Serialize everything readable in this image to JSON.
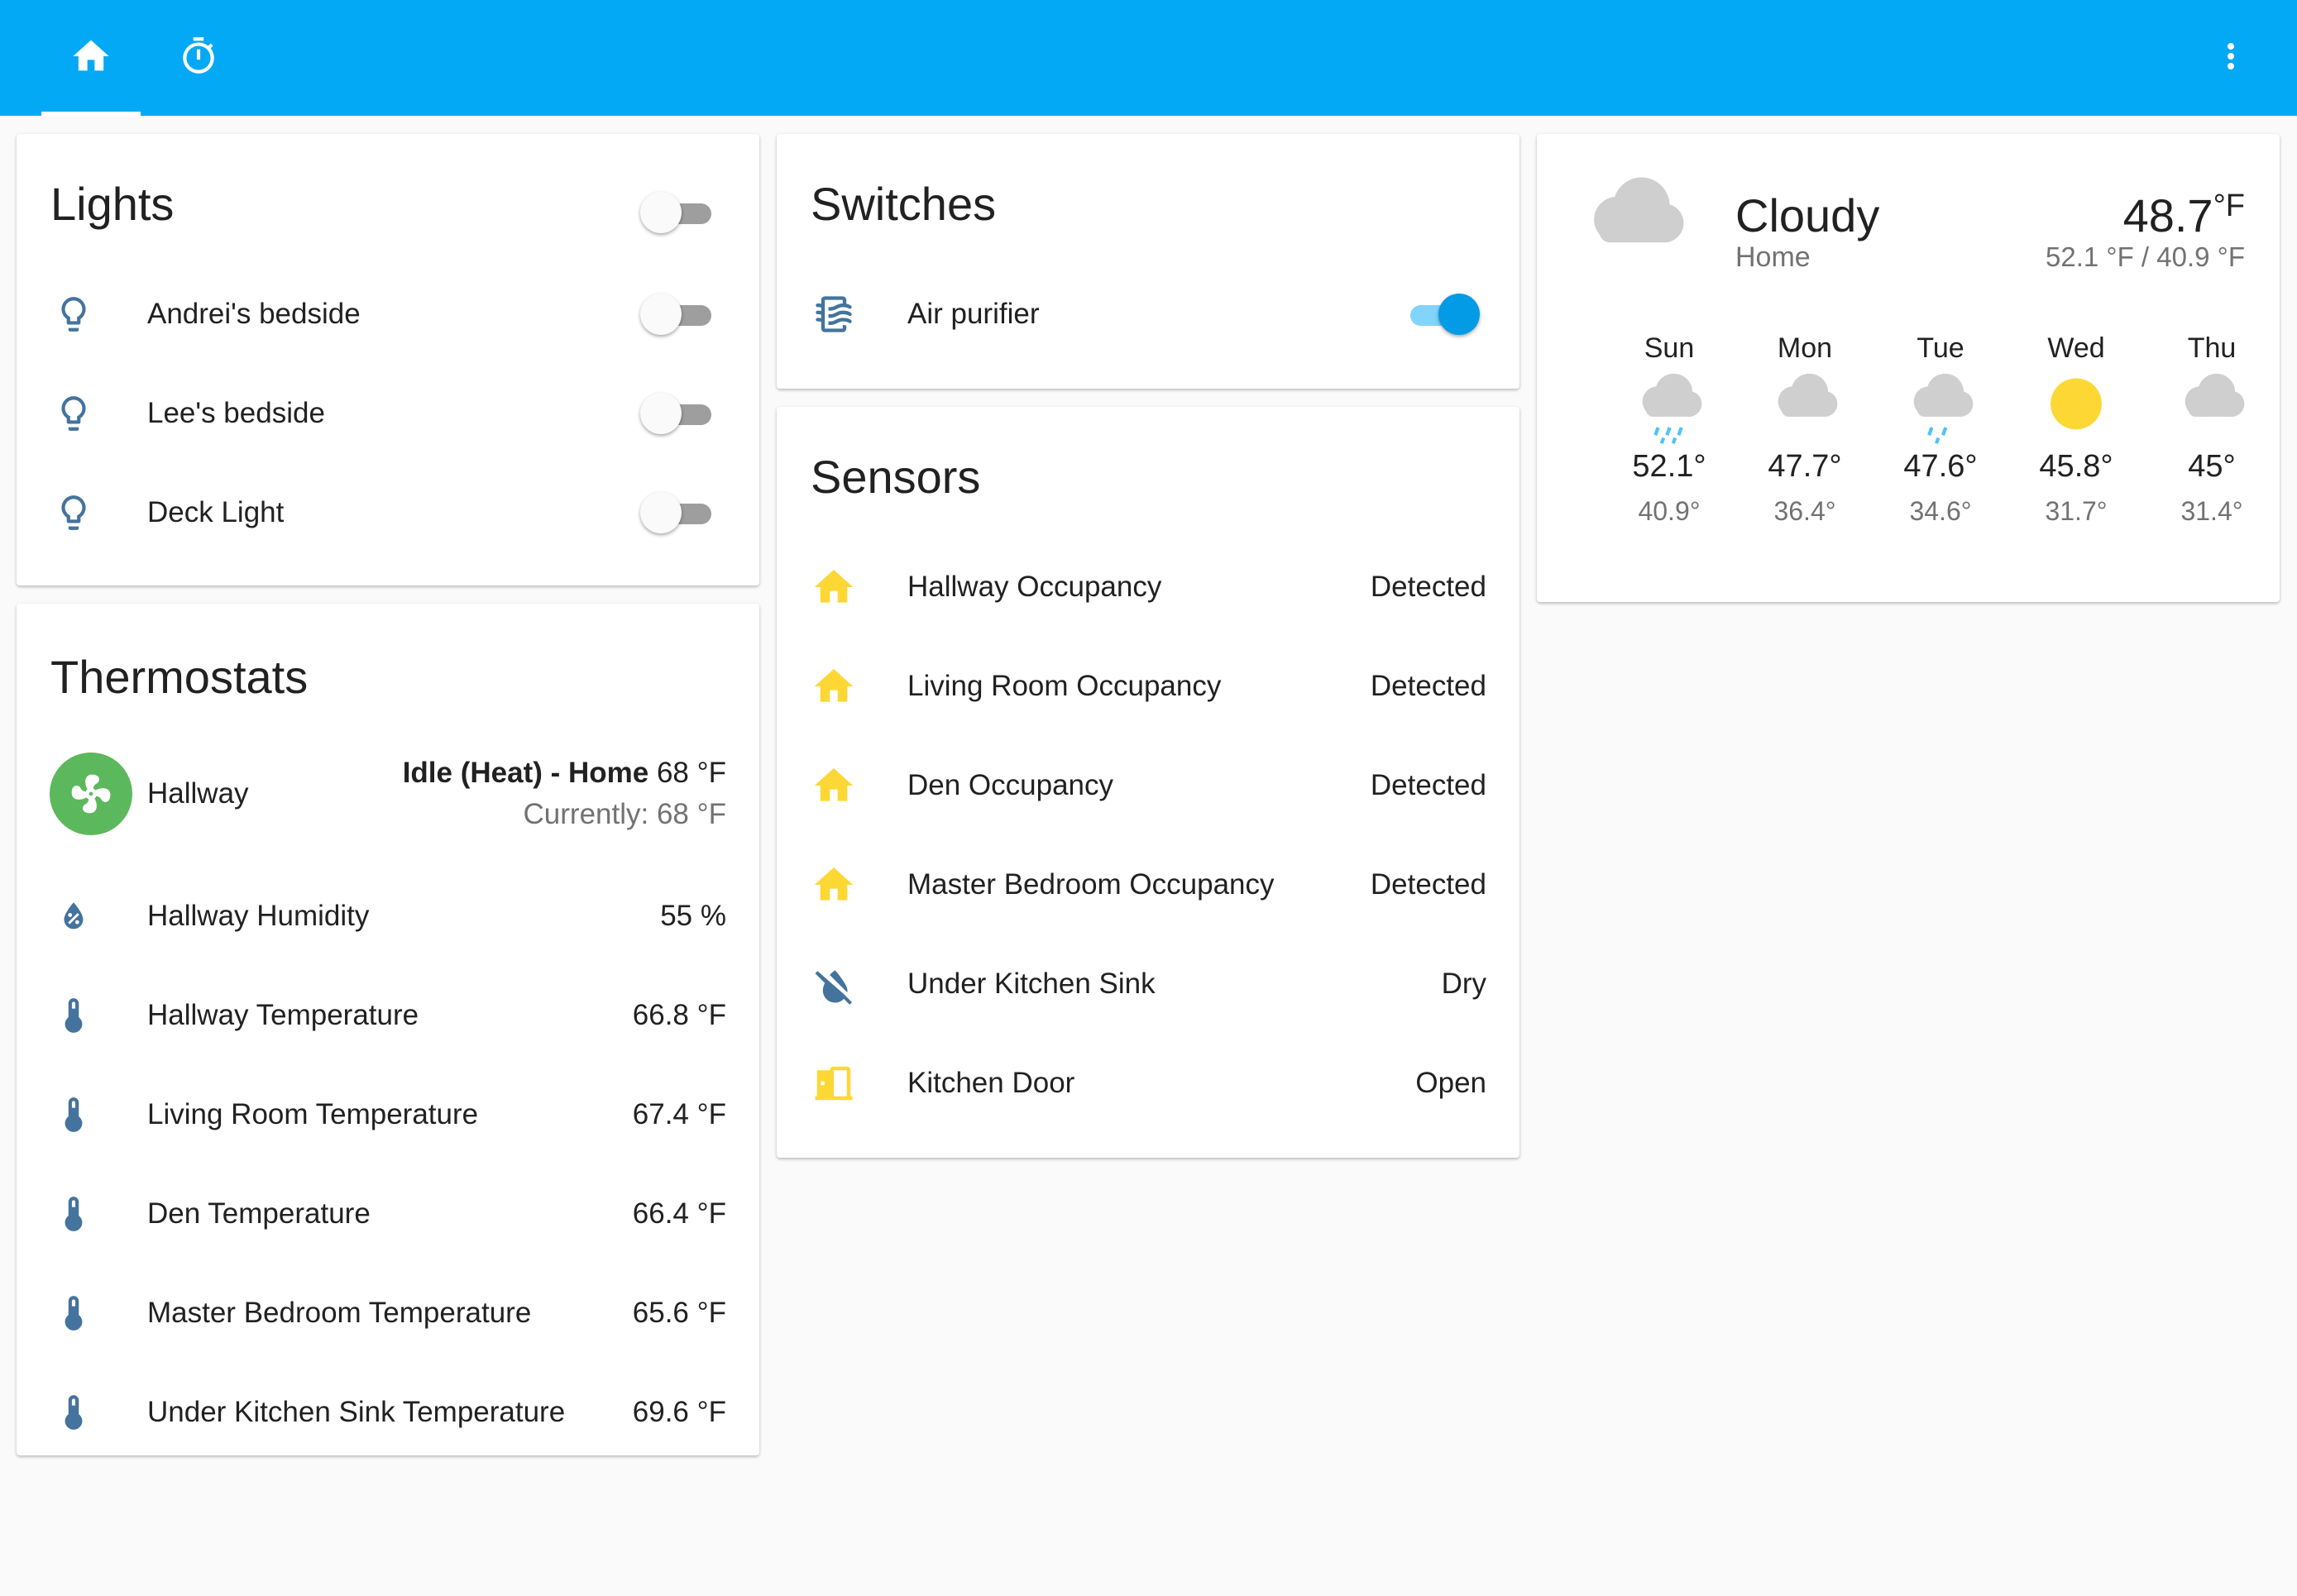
{
  "topbar": {
    "tabs": [
      {
        "icon": "home-icon"
      },
      {
        "icon": "timer-icon"
      }
    ],
    "menu_icon": "more-vertical-icon"
  },
  "colors": {
    "header": "#03a9f4",
    "icon_blue": "#44739e",
    "icon_yellow": "#fdd835",
    "switch_on": "#039be5",
    "thermostat_badge": "#5cb85c"
  },
  "lights": {
    "title": "Lights",
    "group_toggle_on": false,
    "items": [
      {
        "name": "Andrei's bedside",
        "icon": "lightbulb-outline-icon",
        "on": false
      },
      {
        "name": "Lee's bedside",
        "icon": "lightbulb-outline-icon",
        "on": false
      },
      {
        "name": "Deck Light",
        "icon": "lightbulb-outline-icon",
        "on": false
      }
    ]
  },
  "thermostats": {
    "title": "Thermostats",
    "main": {
      "name": "Hallway",
      "state_bold": "Idle (Heat) - Home",
      "target": "68 °F",
      "current": "Currently: 68 °F"
    },
    "items": [
      {
        "name": "Hallway Humidity",
        "value": "55 %",
        "icon": "water-percent-icon"
      },
      {
        "name": "Hallway Temperature",
        "value": "66.8 °F",
        "icon": "thermometer-icon"
      },
      {
        "name": "Living Room Temperature",
        "value": "67.4 °F",
        "icon": "thermometer-icon"
      },
      {
        "name": "Den Temperature",
        "value": "66.4 °F",
        "icon": "thermometer-icon"
      },
      {
        "name": "Master Bedroom Temperature",
        "value": "65.6 °F",
        "icon": "thermometer-icon"
      },
      {
        "name": "Under Kitchen Sink Temperature",
        "value": "69.6 °F",
        "icon": "thermometer-icon"
      }
    ]
  },
  "switches": {
    "title": "Switches",
    "items": [
      {
        "name": "Air purifier",
        "icon": "air-filter-icon",
        "on": true
      }
    ]
  },
  "sensors": {
    "title": "Sensors",
    "items": [
      {
        "name": "Hallway Occupancy",
        "value": "Detected",
        "icon": "home-occupied-icon"
      },
      {
        "name": "Living Room Occupancy",
        "value": "Detected",
        "icon": "home-occupied-icon"
      },
      {
        "name": "Den Occupancy",
        "value": "Detected",
        "icon": "home-occupied-icon"
      },
      {
        "name": "Master Bedroom Occupancy",
        "value": "Detected",
        "icon": "home-occupied-icon"
      },
      {
        "name": "Under Kitchen Sink",
        "value": "Dry",
        "icon": "water-off-icon"
      },
      {
        "name": "Kitchen Door",
        "value": "Open",
        "icon": "door-open-icon"
      }
    ]
  },
  "weather": {
    "condition": "Cloudy",
    "location": "Home",
    "temperature": "48.7",
    "unit": "°F",
    "high_low": "52.1 °F / 40.9 °F",
    "forecast": [
      {
        "day": "Sun",
        "high": "52.1°",
        "low": "40.9°",
        "icon": "rainy-icon"
      },
      {
        "day": "Mon",
        "high": "47.7°",
        "low": "36.4°",
        "icon": "cloudy-icon"
      },
      {
        "day": "Tue",
        "high": "47.6°",
        "low": "34.6°",
        "icon": "rainy-icon"
      },
      {
        "day": "Wed",
        "high": "45.8°",
        "low": "31.7°",
        "icon": "sunny-icon"
      },
      {
        "day": "Thu",
        "high": "45°",
        "low": "31.4°",
        "icon": "cloudy-icon"
      }
    ]
  }
}
